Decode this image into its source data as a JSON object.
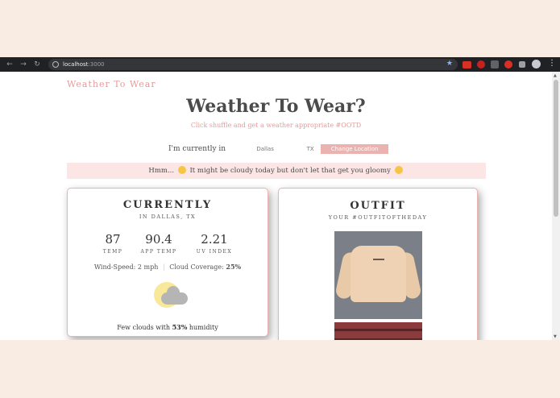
{
  "browser": {
    "url_host": "localhost",
    "url_port": ":3000"
  },
  "app": {
    "brand": "Weather To Wear",
    "title": "Weather To Wear?",
    "subtitle": "Click shuffle and get a weather appropriate #OOTD"
  },
  "location": {
    "label": "I'm currently in",
    "city": "Dallas",
    "state": "TX",
    "button_label": "Change Location"
  },
  "banner": {
    "text_before": "Hmm...",
    "text_after": "It might be cloudy today but don't let that get you gloomy"
  },
  "currently": {
    "heading": "CURRENTLY",
    "location": "IN DALLAS, TX",
    "stats": [
      {
        "value": "87",
        "label": "TEMP"
      },
      {
        "value": "90.4",
        "label": "APP TEMP"
      },
      {
        "value": "2.21",
        "label": "UV INDEX"
      }
    ],
    "wind_label": "Wind-Speed:",
    "wind_value": "2 mph",
    "cloud_label": "Cloud Coverage:",
    "cloud_value": "25%",
    "icon": "few-clouds-icon",
    "humidity_prefix": "Few clouds with",
    "humidity_value": "53%",
    "humidity_suffix": "humidity"
  },
  "outfit": {
    "heading": "OUTFIT",
    "subheading": "YOUR #OUTFITOFTHEDAY"
  },
  "colors": {
    "accent_pink": "#e79b98",
    "button_pink": "#eab3b0",
    "banner_bg": "#fbe5e5",
    "page_bg": "#f9ece2"
  }
}
